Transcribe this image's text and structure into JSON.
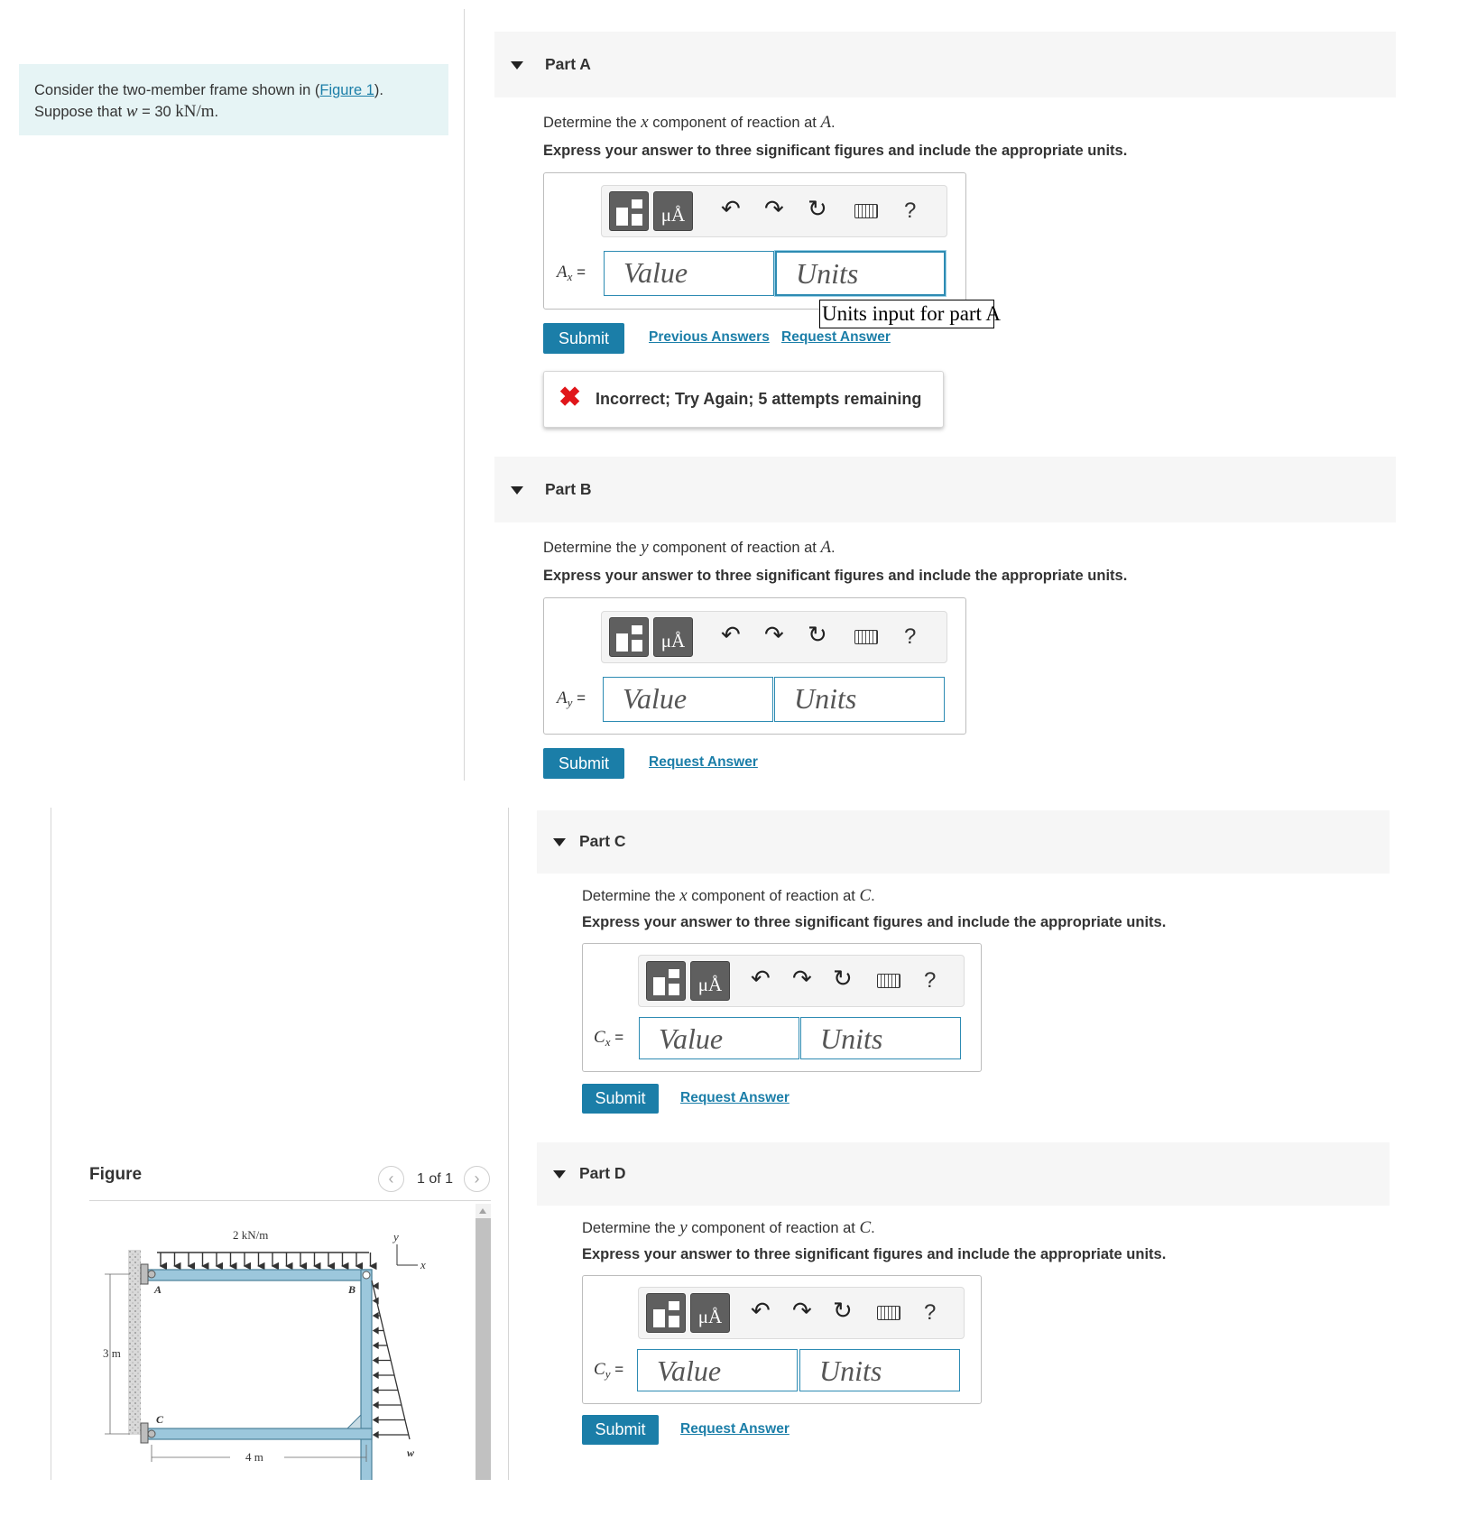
{
  "problem": {
    "text_before": "Consider the two-member frame shown in (",
    "figure_link": "Figure 1",
    "text_after": ").",
    "line2_prefix": "Suppose that ",
    "w_var": "w",
    "equals": " = 30 ",
    "w_units": "kN/m",
    "period": "."
  },
  "parts": [
    {
      "title": "Part A",
      "question_prefix": "Determine the ",
      "component": "x",
      "question_mid": " component of reaction at ",
      "point": "A",
      "question_end": ".",
      "instruction": "Express your answer to three significant figures and include the appropriate units.",
      "var_main": "A",
      "var_sub": "x",
      "value_placeholder": "Value",
      "units_placeholder": "Units",
      "submit": "Submit",
      "links": [
        "Previous Answers",
        "Request Answer"
      ],
      "tooltip": "Units input for part A",
      "feedback": "Incorrect; Try Again; 5 attempts remaining"
    },
    {
      "title": "Part B",
      "question_prefix": "Determine the ",
      "component": "y",
      "question_mid": " component of reaction at ",
      "point": "A",
      "question_end": ".",
      "instruction": "Express your answer to three significant figures and include the appropriate units.",
      "var_main": "A",
      "var_sub": "y",
      "value_placeholder": "Value",
      "units_placeholder": "Units",
      "submit": "Submit",
      "links": [
        "Request Answer"
      ]
    },
    {
      "title": "Part C",
      "question_prefix": "Determine the ",
      "component": "x",
      "question_mid": " component of reaction at ",
      "point": "C",
      "question_end": ".",
      "instruction": "Express your answer to three significant figures and include the appropriate units.",
      "var_main": "C",
      "var_sub": "x",
      "value_placeholder": "Value",
      "units_placeholder": "Units",
      "submit": "Submit",
      "links": [
        "Request Answer"
      ]
    },
    {
      "title": "Part D",
      "question_prefix": "Determine the ",
      "component": "y",
      "question_mid": " component of reaction at ",
      "point": "C",
      "question_end": ".",
      "instruction": "Express your answer to three significant figures and include the appropriate units.",
      "var_main": "C",
      "var_sub": "y",
      "value_placeholder": "Value",
      "units_placeholder": "Units",
      "submit": "Submit",
      "links": [
        "Request Answer"
      ]
    }
  ],
  "toolbar": {
    "units_button": "μÅ",
    "help": "?",
    "icons": [
      "templates-icon",
      "units-icon",
      "undo-icon",
      "redo-icon",
      "reset-icon",
      "keyboard-icon",
      "help-icon"
    ]
  },
  "figure": {
    "title": "Figure",
    "counter": "1 of 1",
    "load_top": "2 kN/m",
    "label_A": "A",
    "label_B": "B",
    "label_C": "C",
    "label_w": "w",
    "dim_height": "3 m",
    "dim_width": "4 m",
    "axis_x": "x",
    "axis_y": "y"
  },
  "colors": {
    "accent": "#1b7ea8",
    "problem_bg": "#e6f4f5",
    "header_bg": "#f6f6f6",
    "error": "#e0161a",
    "frame_member": "#9cc7dc"
  }
}
